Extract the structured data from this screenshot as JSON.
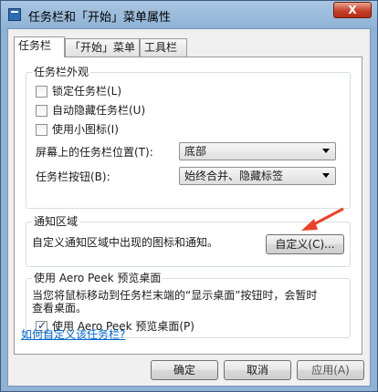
{
  "window": {
    "title": "任务栏和「开始」菜单属性",
    "close_label": "X"
  },
  "tabs": [
    {
      "label": "任务栏",
      "active": true
    },
    {
      "label": "「开始」菜单",
      "active": false
    },
    {
      "label": "工具栏",
      "active": false
    }
  ],
  "appearance": {
    "title": "任务栏外观",
    "lock": {
      "label": "锁定任务栏(L)",
      "checked": false
    },
    "autohide": {
      "label": "自动隐藏任务栏(U)",
      "checked": false
    },
    "small_icons": {
      "label": "使用小图标(I)",
      "checked": false
    },
    "position": {
      "label": "屏幕上的任务栏位置(T):",
      "value": "底部"
    },
    "buttons": {
      "label": "任务栏按钮(B):",
      "value": "始终合并、隐藏标签"
    }
  },
  "notification": {
    "title": "通知区域",
    "desc": "自定义通知区域中出现的图标和通知。",
    "customize_label": "自定义(C)..."
  },
  "aero_peek": {
    "title": "使用 Aero Peek 预览桌面",
    "desc_line1": "当您将鼠标移动到任务栏末端的“显示桌面”按钮时，会暂时",
    "desc_line2": "查看桌面。",
    "checkbox": {
      "label": "使用 Aero Peek 预览桌面(P)",
      "checked": true
    }
  },
  "help_link": "如何自定义该任务栏?",
  "footer": {
    "ok": "确定",
    "cancel": "取消",
    "apply": "应用(A)"
  },
  "colors": {
    "annotation_arrow": "#e8432a",
    "link": "#0066cc"
  }
}
